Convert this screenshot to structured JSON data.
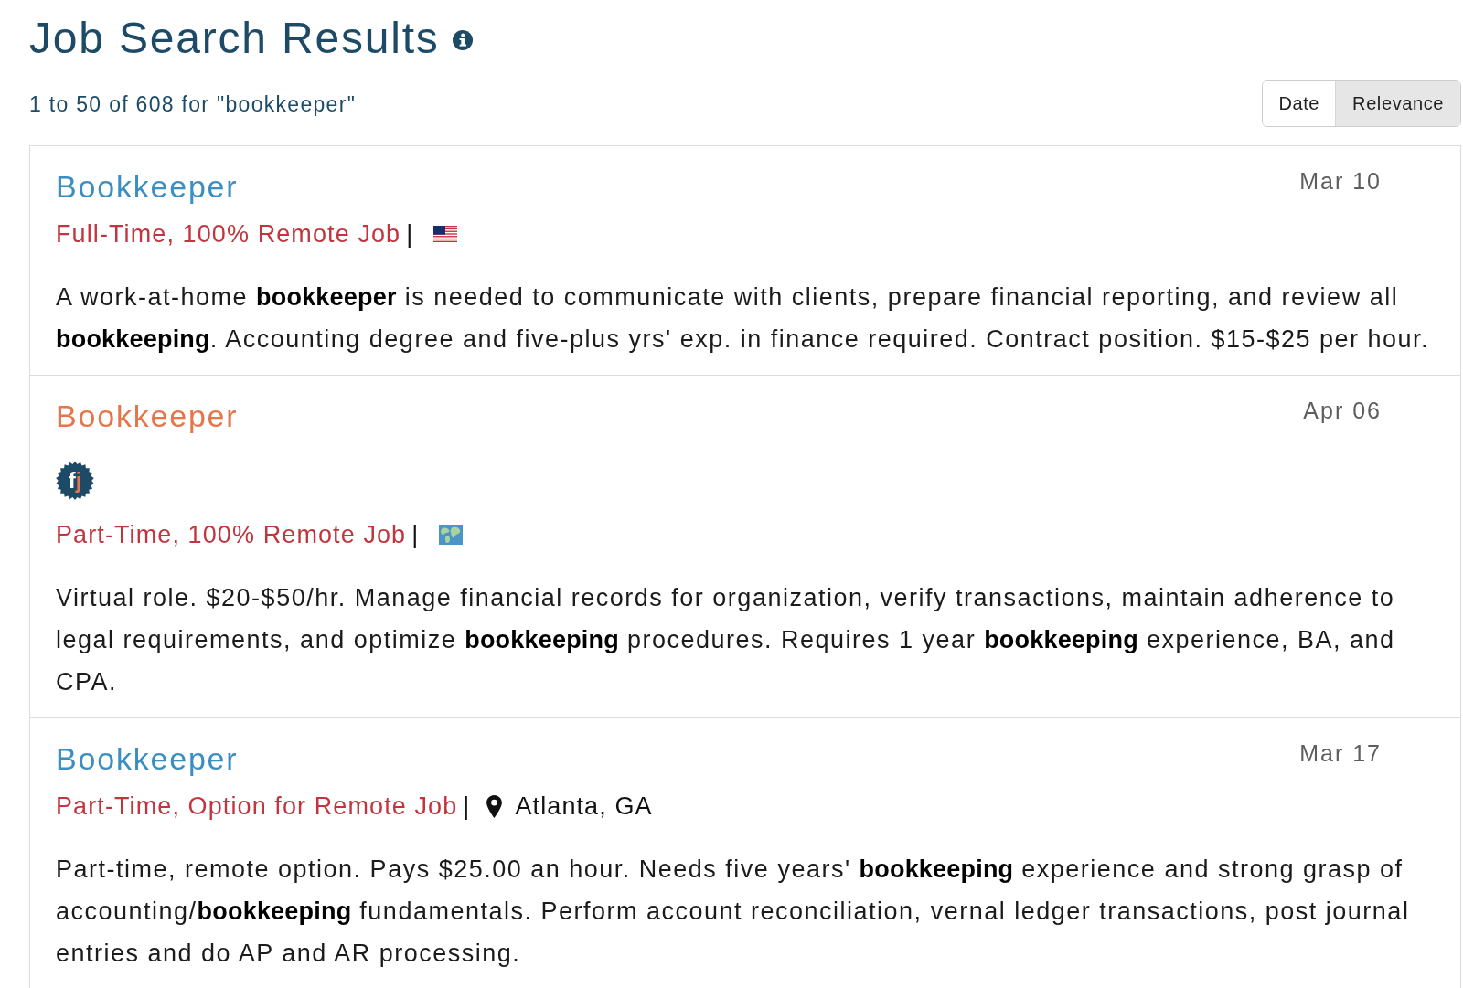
{
  "page": {
    "title": "Job Search Results",
    "summary": "1 to 50 of 608 for \"bookkeeper\""
  },
  "sort": [
    {
      "label": "Date",
      "selected": false
    },
    {
      "label": "Relevance",
      "selected": true
    }
  ],
  "jobs": [
    {
      "title": "Bookkeeper",
      "visited": false,
      "date": "Mar 10",
      "schedule": "Full-Time, 100% Remote Job",
      "divider": "|",
      "location": {
        "kind": "flag"
      },
      "description": "A work-at-home **bookkeeper** is needed to communicate with clients, prepare financial reporting, and review all **bookkeeping**. Accounting degree and five-plus yrs' exp. in finance required. Contract position. $15-$25 per hour."
    },
    {
      "title": "Bookkeeper",
      "visited": true,
      "date": "Apr 06",
      "badge": "fj",
      "schedule": "Part-Time, 100% Remote Job",
      "divider": "|",
      "location": {
        "kind": "globe"
      },
      "description": "Virtual role. $20-$50/hr. Manage financial records for organization, verify transactions, maintain adherence to legal requirements, and optimize **bookkeeping** procedures. Requires 1 year **bookkeeping** experience, BA, and CPA."
    },
    {
      "title": "Bookkeeper",
      "visited": false,
      "date": "Mar 17",
      "schedule": "Part-Time, Option for Remote Job",
      "divider": "|",
      "location": {
        "kind": "city",
        "text": "Atlanta, GA"
      },
      "description": "Part-time, remote option. Pays $25.00 an hour. Needs five years' **bookkeeping** experience and strong grasp of accounting/**bookkeeping** fundamentals. Perform account reconciliation, vernal ledger transactions, post journal entries and do AP and AR processing."
    }
  ]
}
